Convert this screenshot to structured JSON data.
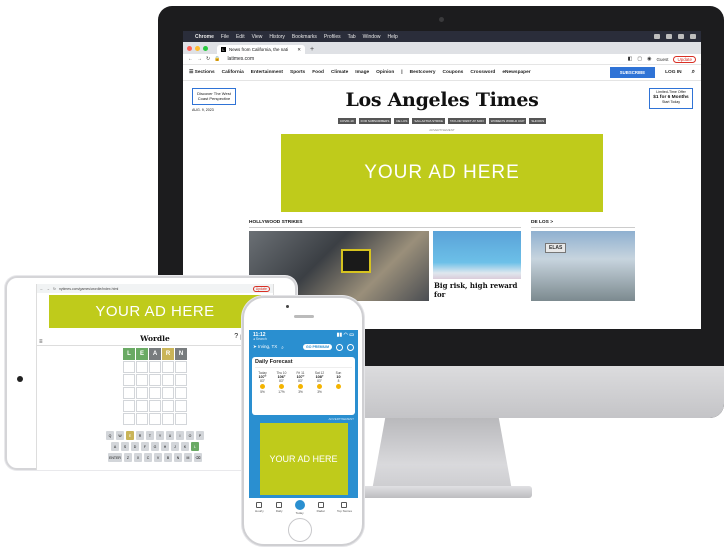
{
  "colors": {
    "ad_green": "#bfcb1b",
    "lat_blue": "#2f73d6",
    "weather_blue": "#2a8fd0",
    "wordle_green": "#6aaa64",
    "wordle_yellow": "#c9b458"
  },
  "imac": {
    "menubar": {
      "app": "Chrome",
      "items": [
        "File",
        "Edit",
        "View",
        "History",
        "Bookmarks",
        "Profiles",
        "Tab",
        "Window",
        "Help"
      ]
    },
    "tab": {
      "title": "News from California, the nati",
      "favicon": "L"
    },
    "url": "latimes.com",
    "guest_label": "Guest",
    "update_label": "Update",
    "site": {
      "sections_label": "☰ Sections",
      "nav": [
        "California",
        "Entertainment",
        "Sports",
        "Food",
        "Climate",
        "Image",
        "Opinion",
        "|",
        "Bestcovery",
        "Coupons",
        "Crossword",
        "eNewspaper"
      ],
      "subscribe": "SUBSCRIBE",
      "login": "LOG IN",
      "logo": "Los Angeles Times",
      "promo_left": "Discover The West Coast Perspective",
      "promo_right": {
        "line1": "Limited-Time Offer",
        "line2": "$1 for 6 Months",
        "line3": "Start Today"
      },
      "date": "AUG. 9, 2023",
      "chips": [
        "COVID-19",
        "FOR SUBSCRIBERS",
        "DE LOS",
        "SAG-AFTRA STRIKE",
        "TAYLOR SWIFT AT SOFI",
        "WOMEN'S WORLD CUP",
        "SHOOKS"
      ],
      "ad_label": "ADVERTISEMENT",
      "ad_text": "YOUR AD HERE",
      "section_hw": "HOLLYWOOD STRIKES",
      "section_de": "DE LOS",
      "section_de_arrow": ">",
      "headline": "Big risk, high reward for",
      "de_tag": "ELAS"
    }
  },
  "ipad": {
    "url": "nytimes.com/games/wordle/index.html",
    "update": "Update",
    "ad_text": "YOUR AD HERE",
    "wordle_title": "Wordle",
    "guess_letters": [
      "L",
      "E",
      "A",
      "R",
      "N"
    ],
    "guess_states": [
      "green",
      "green",
      "gray",
      "yellow",
      "gray"
    ],
    "kb_row1": [
      "Q",
      "W",
      "E",
      "R",
      "T",
      "Y",
      "U",
      "I",
      "O",
      "P"
    ],
    "kb_row2": [
      "A",
      "S",
      "D",
      "F",
      "G",
      "H",
      "J",
      "K",
      "L"
    ],
    "kb_row3": [
      "ENTER",
      "Z",
      "X",
      "C",
      "V",
      "B",
      "N",
      "M",
      "⌫"
    ],
    "kb_states_row1": [
      "",
      "",
      "y",
      "",
      "",
      "",
      "",
      "",
      "",
      ""
    ],
    "kb_states_row2": [
      "",
      "",
      "",
      "",
      "",
      "",
      "",
      "",
      "g"
    ],
    "kb_states_row3": [
      "",
      "",
      "",
      "",
      "",
      "",
      "",
      "",
      ""
    ]
  },
  "iphone": {
    "time": "11:12",
    "sub": "◂ Search",
    "location": "➤ Irving, TX",
    "premium": "GO PREMIUM",
    "forecast_title": "Daily Forecast",
    "days": [
      {
        "day": "Today",
        "hi": "107°",
        "lo": "83°",
        "p": "5%"
      },
      {
        "day": "Thu 10",
        "hi": "106°",
        "lo": "83°",
        "p": "17%"
      },
      {
        "day": "Fri 11",
        "hi": "107°",
        "lo": "83°",
        "p": "3%"
      },
      {
        "day": "Sat 12",
        "hi": "108°",
        "lo": "83°",
        "p": "3%"
      },
      {
        "day": "Sun",
        "hi": "10",
        "lo": "8",
        "p": ""
      }
    ],
    "ad_label": "ADVERTISEMENT",
    "ad_text": "YOUR AD HERE",
    "tabs": [
      "Hourly",
      "Daily",
      "Today",
      "Radar",
      "Top Stories"
    ]
  }
}
